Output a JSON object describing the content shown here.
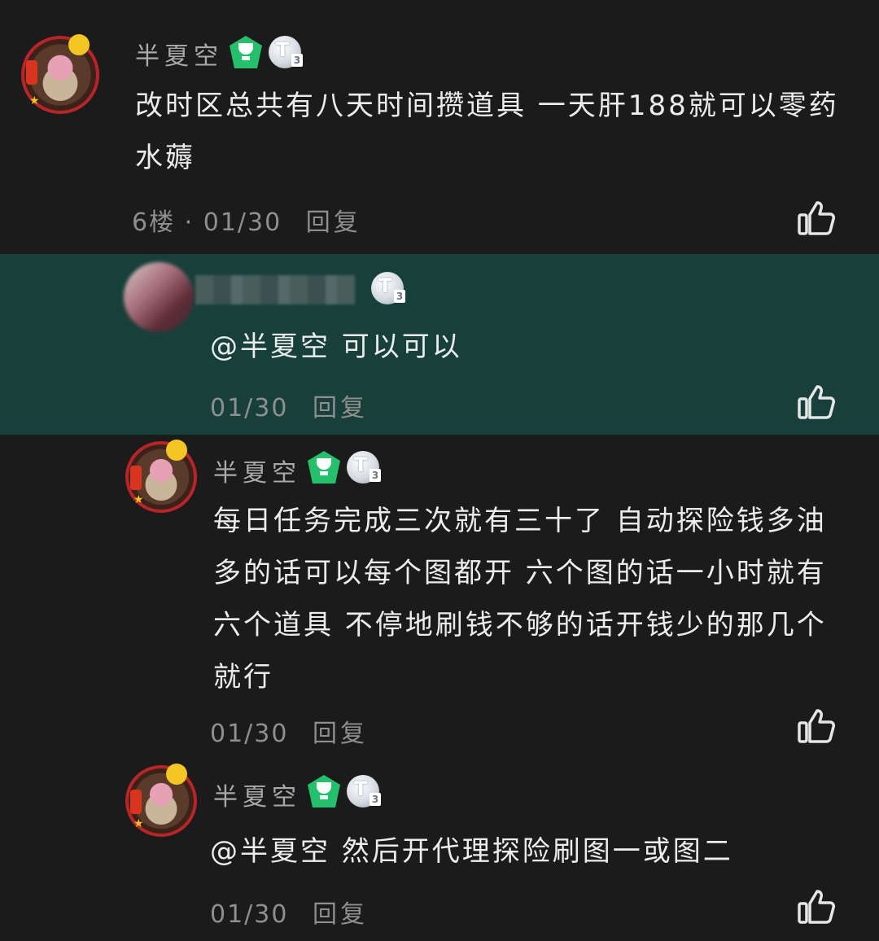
{
  "comments": [
    {
      "username": "半夏空",
      "content": "改时区总共有八天时间攒道具 一天肝188就可以零药水薅",
      "floor": "6楼",
      "separator": "·",
      "date": "01/30",
      "reply_label": "回复",
      "level_badge": "trophy-icon",
      "tier_badge": "T",
      "tier_sub": "3"
    },
    {
      "username": "",
      "content": "@半夏空 可以可以",
      "date": "01/30",
      "reply_label": "回复",
      "tier_badge": "T",
      "tier_sub": "3",
      "highlighted": true,
      "highlight_color": "#18403a"
    },
    {
      "username": "半夏空",
      "content": "每日任务完成三次就有三十了 自动探险钱多油多的话可以每个图都开 六个图的话一小时就有六个道具 不停地刷钱不够的话开钱少的那几个就行",
      "date": "01/30",
      "reply_label": "回复",
      "level_badge": "trophy-icon",
      "tier_badge": "T",
      "tier_sub": "3"
    },
    {
      "username": "半夏空",
      "content": "@半夏空 然后开代理探险刷图一或图二",
      "date": "01/30",
      "reply_label": "回复",
      "level_badge": "trophy-icon",
      "tier_badge": "T",
      "tier_sub": "3"
    }
  ],
  "colors": {
    "background": "#1b1b1b",
    "text": "#ececec",
    "muted": "#8f8f8f",
    "level_badge": "#24c06c"
  },
  "icons": {
    "like": "thumbs-up-icon"
  }
}
